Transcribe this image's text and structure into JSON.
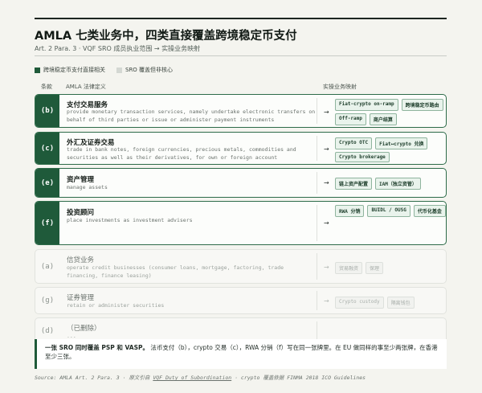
{
  "title": "AMLA 七类业务中，四类直接覆盖跨境稳定币支付",
  "subtitle": "Art. 2 Para. 3 · VQF SRO 成员执业范围 → 实操业务映射",
  "legend": {
    "direct": "跨境稳定币支付直接相关",
    "other": "SRO 覆盖但非核心"
  },
  "headers": {
    "code": "条款",
    "definition": "AMLA 法律定义",
    "mapping": "实操业务映射"
  },
  "rows": [
    {
      "code": "(b)",
      "name": "支付交易服务",
      "def": "provide monetary transaction services, namely undertake electronic transfers on behalf of third parties or issue or administer payment instruments",
      "active": true,
      "tags": [
        "Fiat-crypto on-ramp",
        "跨境稳定币路由",
        "Off-ramp",
        "商户结算"
      ]
    },
    {
      "code": "(c)",
      "name": "外汇及证券交易",
      "def": "trade in bank notes, foreign currencies, precious metals, commodities and securities as well as their derivatives, for own or foreign account",
      "active": true,
      "tags": [
        "Crypto OTC",
        "Fiat↔crypto 兑换",
        "Crypto brokerage"
      ]
    },
    {
      "code": "(e)",
      "name": "资产管理",
      "def": "manage assets",
      "active": true,
      "tags": [
        "链上资产配置",
        "IAM（独立资管）"
      ]
    },
    {
      "code": "(f)",
      "name": "投资顾问",
      "def": "place investments as investment advisers",
      "active": true,
      "tags": [
        "RWA 分销",
        "BUIDL / OUSG",
        "代币化基金"
      ]
    },
    {
      "code": "(a)",
      "name": "信贷业务",
      "def": "operate credit businesses (consumer loans, mortgage, factoring, trade financing, finance leasing)",
      "active": false,
      "tags": [
        "贸易融资",
        "保理"
      ]
    },
    {
      "code": "(g)",
      "name": "证券管理",
      "def": "retain or administer securities",
      "active": false,
      "tags": [
        "Crypto custody",
        "隔离钱包"
      ]
    },
    {
      "code": "(d)",
      "name": "（已删除）",
      "def": "...",
      "active": false,
      "tags": []
    }
  ],
  "callout": {
    "bold": "一张 SRO 同时覆盖 PSP 和 VASP。",
    "text": "法币支付（b），crypto 交易（c），RWA 分销（f）写在同一张牌里。在 EU 做同样的事至少两张牌，在香港至少三张。"
  },
  "source": {
    "prefix": "Source: AMLA Art. 2 Para. 3 · 原文引自",
    "link": "VQF Duty of Subordination",
    "suffix": "· crypto 覆盖依据 FINMA 2018 ICO Guidelines"
  },
  "colors": {
    "accent": "#1f5a3a",
    "tag_bg": "#e9f3ec",
    "tag_border": "#8fb49e"
  }
}
